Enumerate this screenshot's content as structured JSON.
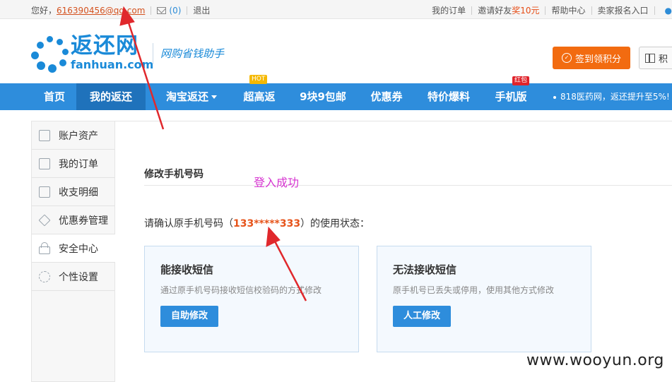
{
  "topbar": {
    "greeting": "您好，",
    "email": "616390456@qq.com",
    "mail_count": "(0)",
    "logout": "退出",
    "my_orders": "我的订单",
    "invite_prefix": "邀请好友",
    "invite_reward": "奖10元",
    "help": "帮助中心",
    "seller": "卖家报名入口"
  },
  "header": {
    "brand": "返还网",
    "domain": "fanhuan.com",
    "slogan": "网购省钱助手",
    "sign_button": "签到领积分",
    "points_button": "积"
  },
  "nav": {
    "items": [
      "首页",
      "我的返还",
      "淘宝返还",
      "超高返",
      "9块9包邮",
      "优惠券",
      "特价爆料",
      "手机版"
    ],
    "hot_badge": "HOT",
    "red_badge": "红包",
    "ticker": "818医药网，返还提升至5%!"
  },
  "sidebar": {
    "items": [
      "账户资产",
      "我的订单",
      "收支明细",
      "优惠券管理",
      "安全中心",
      "个性设置"
    ]
  },
  "main": {
    "section_title": "修改手机号码",
    "annotation": "登入成功",
    "confirm_prefix": "请确认原手机号码（",
    "phone": "133*****333",
    "confirm_suffix": "）的使用状态：",
    "cards": [
      {
        "title": "能接收短信",
        "desc": "通过原手机号码接收短信校验码的方式修改",
        "button": "自助修改"
      },
      {
        "title": "无法接收短信",
        "desc": "原手机号已丢失或停用，使用其他方式修改",
        "button": "人工修改"
      }
    ]
  },
  "watermark": "www.wooyun.org",
  "colors": {
    "nav_blue": "#2e8ddc",
    "nav_active": "#1f72bb",
    "orange": "#f26b10",
    "annotation_arrow": "#e0282c"
  }
}
